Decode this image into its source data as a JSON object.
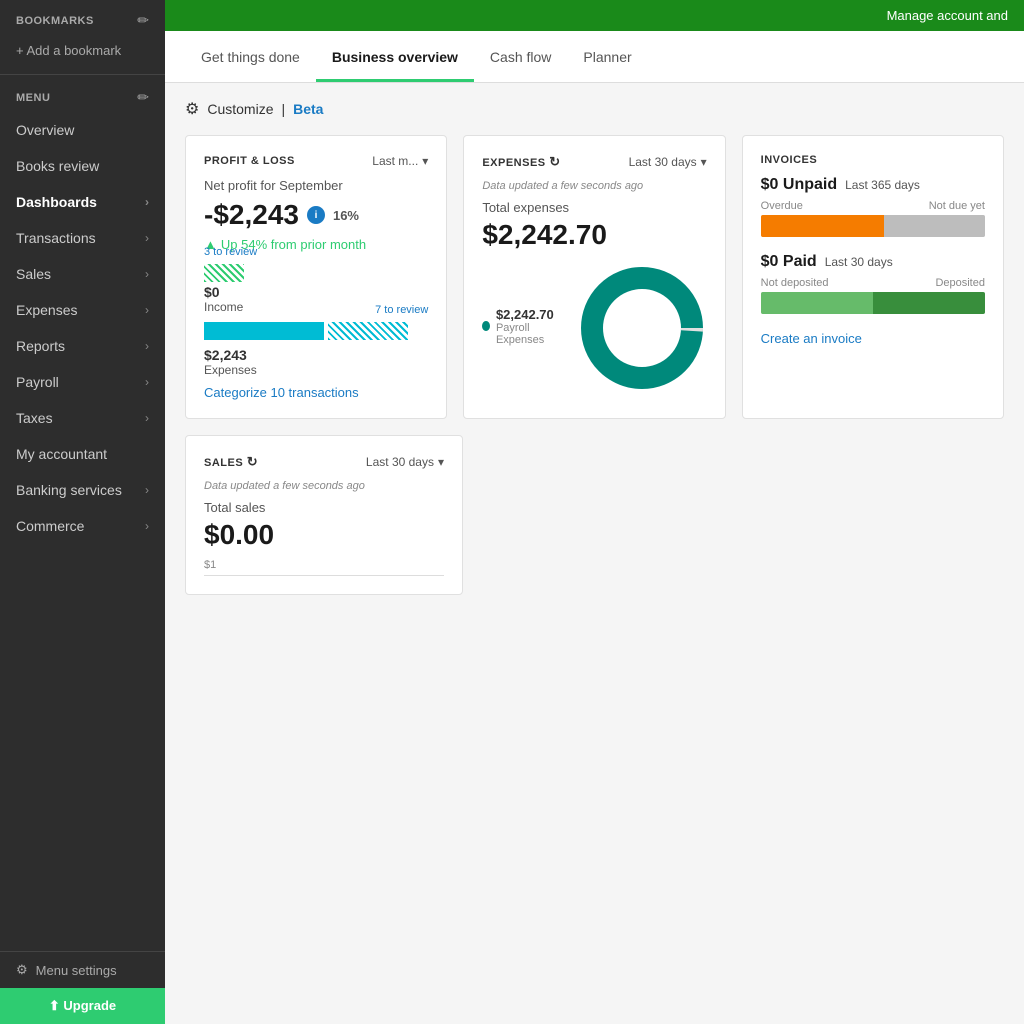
{
  "sidebar": {
    "bookmarks_title": "BOOKMARKS",
    "add_bookmark_label": "+ Add a bookmark",
    "menu_title": "MENU",
    "items": [
      {
        "label": "Overview",
        "has_chevron": false
      },
      {
        "label": "Books review",
        "has_chevron": false
      },
      {
        "label": "Dashboards",
        "has_chevron": true,
        "active": true
      },
      {
        "label": "Transactions",
        "has_chevron": true
      },
      {
        "label": "Sales",
        "has_chevron": true
      },
      {
        "label": "Expenses",
        "has_chevron": true
      },
      {
        "label": "Reports",
        "has_chevron": true
      },
      {
        "label": "Payroll",
        "has_chevron": true
      },
      {
        "label": "Taxes",
        "has_chevron": true
      },
      {
        "label": "My accountant",
        "has_chevron": false
      },
      {
        "label": "Banking services",
        "has_chevron": true
      },
      {
        "label": "Commerce",
        "has_chevron": true
      }
    ],
    "footer": {
      "menu_settings": "Menu settings",
      "green_button": "⬆ Upgrade"
    }
  },
  "topbar": {
    "text": "Manage account and"
  },
  "tabs": {
    "items": [
      {
        "label": "Get things done",
        "active": false
      },
      {
        "label": "Business overview",
        "active": true
      },
      {
        "label": "Cash flow",
        "active": false
      },
      {
        "label": "Planner",
        "active": false
      }
    ]
  },
  "customize": {
    "label": "Customize",
    "separator": "|",
    "beta": "Beta"
  },
  "profit_loss": {
    "title": "PROFIT & LOSS",
    "period": "Last m...",
    "subtitle": "Net profit for September",
    "value": "-$2,243",
    "badge": "i",
    "percentage": "16%",
    "change": "Up 54% from prior month",
    "income_review": "3 to review",
    "income_value": "$0",
    "income_label": "Income",
    "expenses_review": "7 to review",
    "expenses_value": "$2,243",
    "expenses_label": "Expenses",
    "categorize_link": "Categorize 10 transactions"
  },
  "expenses": {
    "title": "EXPENSES",
    "period": "Last 30 days",
    "updated": "Data updated a few seconds ago",
    "subtitle": "Total expenses",
    "value": "$2,242.70",
    "legend_amount": "$2,242.70",
    "legend_label": "Payroll Expenses"
  },
  "invoices": {
    "title": "INVOICES",
    "unpaid_amount": "$0 Unpaid",
    "unpaid_period": "Last 365 days",
    "overdue_label": "Overdue",
    "not_due_label": "Not due yet",
    "paid_amount": "$0 Paid",
    "paid_period": "Last 30 days",
    "not_deposited_label": "Not deposited",
    "deposited_label": "Deposited",
    "create_link": "Create an invoice"
  },
  "sales": {
    "title": "SALES",
    "period": "Last 30 days",
    "updated": "Data updated a few seconds ago",
    "subtitle": "Total sales",
    "value": "$0.00",
    "axis_label": "$1"
  },
  "colors": {
    "sidebar_bg": "#2d2d2d",
    "active_tab_border": "#2ecc71",
    "teal": "#00897b",
    "orange": "#f57c00",
    "green1": "#66bb6a",
    "green2": "#388e3c",
    "blue_link": "#1a7bc4"
  }
}
